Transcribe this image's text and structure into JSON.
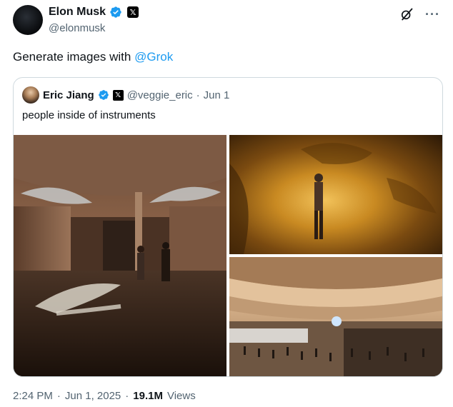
{
  "author": {
    "name": "Elon Musk",
    "handle": "@elonmusk"
  },
  "tweet": {
    "text_prefix": "Generate images with ",
    "mention": "@Grok"
  },
  "quote": {
    "name": "Eric Jiang",
    "handle": "@veggie_eric",
    "separator": "·",
    "date": "Jun 1",
    "text": "people inside of instruments"
  },
  "footer": {
    "time": "2:24 PM",
    "separator1": "·",
    "date": "Jun 1, 2025",
    "separator2": "·",
    "views_count": "19.1M",
    "views_label": "Views"
  },
  "colors": {
    "link": "#1d9bf0",
    "verified": "#1d9bf0",
    "muted": "#536471",
    "text": "#0f1419"
  },
  "icons": {
    "verified": "verified-badge-icon",
    "affiliate": "x-affiliate-icon",
    "grok": "grok-icon",
    "more": "more-icon"
  }
}
